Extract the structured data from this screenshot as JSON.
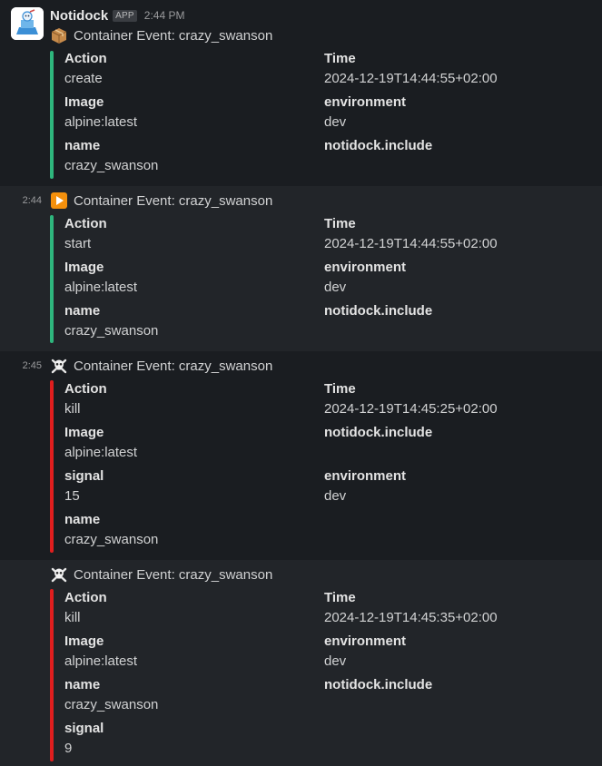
{
  "app": {
    "sender": "Notidock",
    "badge": "APP",
    "time": "2:44 PM"
  },
  "colors": {
    "green": "#2eb67d",
    "red": "#e01e1e"
  },
  "messages": [
    {
      "side_time": "",
      "icon": "package-icon",
      "title": "Container Event: crazy_swanson",
      "left": [
        {
          "label": "Action",
          "value": "create"
        },
        {
          "label": "Image",
          "value": "alpine:latest"
        },
        {
          "label": "name",
          "value": "crazy_swanson"
        }
      ],
      "right": [
        {
          "label": "Time",
          "value": "2024-12-19T14:44:55+02:00"
        },
        {
          "label": "environment",
          "value": "dev"
        },
        {
          "label": "notidock.include",
          "value": ""
        }
      ]
    },
    {
      "side_time": "2:44",
      "icon": "play-icon",
      "title": "Container Event: crazy_swanson",
      "left": [
        {
          "label": "Action",
          "value": "start"
        },
        {
          "label": "Image",
          "value": "alpine:latest"
        },
        {
          "label": "name",
          "value": "crazy_swanson"
        }
      ],
      "right": [
        {
          "label": "Time",
          "value": "2024-12-19T14:44:55+02:00"
        },
        {
          "label": "environment",
          "value": "dev"
        },
        {
          "label": "notidock.include",
          "value": ""
        }
      ]
    },
    {
      "side_time": "2:45",
      "icon": "skull-crossbones-icon",
      "title": "Container Event: crazy_swanson",
      "left": [
        {
          "label": "Action",
          "value": "kill"
        },
        {
          "label": "Image",
          "value": "alpine:latest"
        },
        {
          "label": "signal",
          "value": "15"
        },
        {
          "label": "name",
          "value": "crazy_swanson"
        }
      ],
      "right": [
        {
          "label": "Time",
          "value": "2024-12-19T14:45:25+02:00"
        },
        {
          "label": "notidock.include",
          "value": ""
        },
        {
          "label": "environment",
          "value": "dev"
        }
      ]
    },
    {
      "side_time": "",
      "icon": "skull-crossbones-icon",
      "title": "Container Event: crazy_swanson",
      "left": [
        {
          "label": "Action",
          "value": "kill"
        },
        {
          "label": "Image",
          "value": "alpine:latest"
        },
        {
          "label": "name",
          "value": "crazy_swanson"
        },
        {
          "label": "signal",
          "value": "9"
        }
      ],
      "right": [
        {
          "label": "Time",
          "value": "2024-12-19T14:45:35+02:00"
        },
        {
          "label": "environment",
          "value": "dev"
        },
        {
          "label": "notidock.include",
          "value": ""
        }
      ]
    }
  ]
}
